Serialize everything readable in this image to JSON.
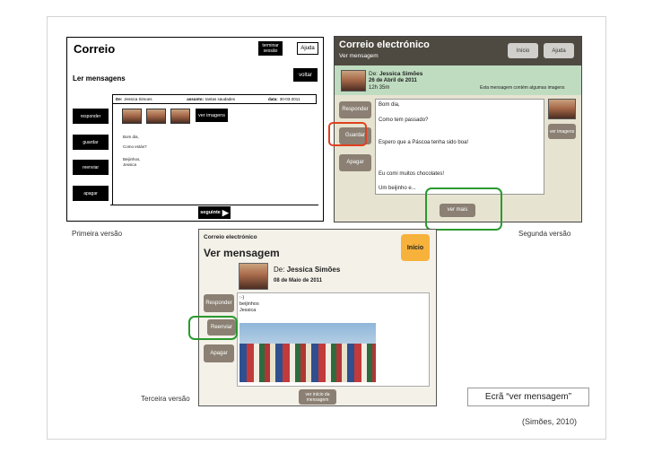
{
  "v1": {
    "title": "Correio",
    "terminar": "terminar sessão",
    "ajuda": "Ajuda",
    "heading": "Ler mensagens",
    "voltar": "voltar",
    "de_label": "De:",
    "de_value": "Jessica Simoes",
    "assunto_label": "assunto:",
    "assunto_value": "tantas saudades",
    "data_label": "data:",
    "data_value": "30-03-2011",
    "side_buttons": [
      "responder",
      "guardar",
      "reenviar",
      "apagar"
    ],
    "ver_imagens": "ver imagens",
    "msg_lines": [
      "Bom dia,",
      "Como estás?",
      "Beijinhos,",
      "Jessica"
    ],
    "seguinte": "seguinte"
  },
  "v2": {
    "title": "Correio electrónico",
    "subtitle": "Ver mensagem",
    "inicio": "Início",
    "ajuda": "Ajuda",
    "de_label": "De:",
    "de_value": "Jessica Simões",
    "date": "26 de Abril de 2011",
    "time": "12h 35m",
    "notice": "Esta mensagem contém algumas imagens",
    "side_buttons": [
      "Responder",
      "Guardar",
      "Apagar"
    ],
    "msg_lines": [
      "Bom dia,",
      "Como tem passado?",
      "Espero que a Páscoa tenha sido boa!",
      "Eu comi muitos chocolates!",
      "Um beijinho e..."
    ],
    "ver_imagens": "ver imagens",
    "ver_mais": "ver mais"
  },
  "v3": {
    "app": "Correio electrónico",
    "title": "Ver mensagem",
    "inicio": "Início",
    "de_label": "De:",
    "de_value": "Jessica Simões",
    "date": "08 de Maio de 2011",
    "side_buttons": [
      "Responder",
      "Reenviar",
      "Apagar"
    ],
    "msg_lines": [
      ":-)",
      "beijinhos",
      "Jessica"
    ],
    "ver_inicio": "ver início da mensagem"
  },
  "captions": {
    "primeira": "Primeira versão",
    "segunda": "Segunda versão",
    "terceira": "Terceira versão",
    "ecra": "Ecrã “ver mensagem”",
    "source": "(Simões, 2010)"
  },
  "colors": {
    "highlight_red": "#e0401f",
    "highlight_green": "#2a9a2f",
    "v2_header": "#4f4a41",
    "v2_strip": "#bfdcc0",
    "button_brown": "#8b8073",
    "inicio_orange": "#f7b23b"
  }
}
